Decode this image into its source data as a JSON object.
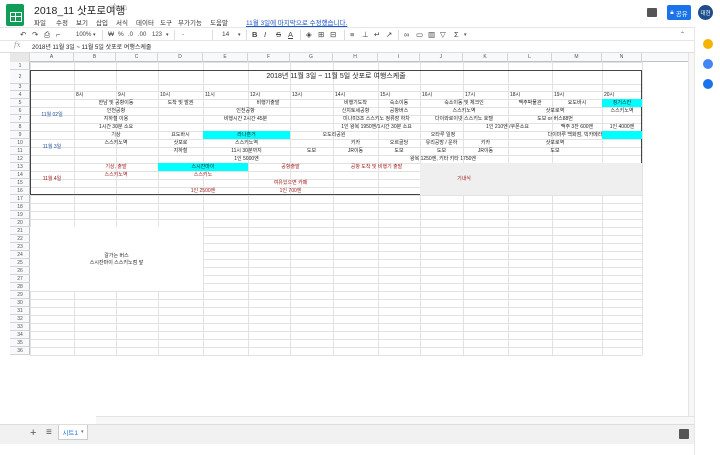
{
  "doc": {
    "title": "2018_11 삿포로여행",
    "last_edit": "11월 3일에 마지막으로 수정했습니다.",
    "share_label": "공유",
    "avatar": "대현"
  },
  "menu": [
    "파일",
    "수정",
    "보기",
    "삽입",
    "서식",
    "데이터",
    "도구",
    "부가기능",
    "도움말"
  ],
  "toolbar": {
    "zoom": "100%",
    "currency": "₩",
    "percent": "%",
    "decimal_dec": ".0",
    "decimal_inc": ".00",
    "format": "123",
    "font_size": "14",
    "bold": "B",
    "italic": "I",
    "strike": "S",
    "textcolor": "A",
    "sum": "Σ"
  },
  "formula_bar": {
    "fx": "fx",
    "value": "2018년 11월 3일 ~ 11월 5일 삿포로 여행스케줄"
  },
  "columns": [
    "A",
    "B",
    "C",
    "D",
    "E",
    "F",
    "G",
    "H",
    "I",
    "J",
    "K",
    "L",
    "M",
    "N"
  ],
  "rows": [
    "1",
    "2",
    "3",
    "4",
    "5",
    "6",
    "7",
    "8",
    "9",
    "10",
    "11",
    "12",
    "13",
    "14",
    "15",
    "16",
    "17",
    "18",
    "19",
    "20",
    "21",
    "22",
    "23",
    "24",
    "25",
    "26",
    "27",
    "28",
    "29",
    "30",
    "31",
    "32",
    "33",
    "34",
    "35",
    "36"
  ],
  "sheet": {
    "title": "2018년 11월 3일 ~ 11월 5일 삿포로 여행스케줄",
    "hours": [
      "8시",
      "9시",
      "10시",
      "11시",
      "12시",
      "13시",
      "14시",
      "15시",
      "16시",
      "17시",
      "18시",
      "19시",
      "20시"
    ],
    "day1": {
      "label": "11월 02일",
      "r5": [
        "한남 및 공항이동",
        "도착 및 발권",
        "비행기출발",
        "비행기도착",
        "숙소이동",
        "숙소이동 및 체크인",
        "맥주박물관",
        "요도바시",
        "징기스칸"
      ],
      "r6": [
        "인천공항",
        "인천공항",
        "신치토세공항",
        "공항버스",
        "스스키노역",
        "삿포로역",
        "스스키노역"
      ],
      "r7": [
        "지하철 이용",
        "비행시간 2시간 45분",
        "미나미3조 스스키노 정류장 하차",
        "다이와로이넷 스스키노 호텔",
        "도보 or 버스88번"
      ],
      "r8": [
        "1시간 30분 소요",
        "1인 왕복 1950엔/1시간 30분 소요",
        "1인 210엔 /쿠폰소요",
        "맥주 3잔 600엔",
        "1인 4000엔"
      ]
    },
    "day2": {
      "label": "11월 3일",
      "r9": [
        "기상",
        "요도바시",
        "라나훈거",
        "오도리공원",
        "오타루 일정",
        "다이마루 백화점, 빅카메라"
      ],
      "r10": [
        "스스키노역",
        "삿포로",
        "스스키노역",
        "키카",
        "오르골당",
        "유리공방 / 운하",
        "키카",
        "삿포로역"
      ],
      "r11": [
        "지하철",
        "11시 30분까지",
        "도보",
        "JR이동",
        "도보",
        "도보",
        "JR이동",
        "도보"
      ],
      "r12": [
        "1인 5000엔",
        "왕복 1250엔, 키타 키타 1750엔"
      ]
    },
    "day3": {
      "label": "11월 4일",
      "r13": [
        "기상, 출발",
        "스시잔마이",
        "공항출발",
        "공항 도착 및 비행기 출발"
      ],
      "r14": [
        "스스키노역",
        "스스키노"
      ],
      "r15": [
        "여유있으면 카페"
      ],
      "r16": [
        "1인 2500엔",
        "1인 700엔"
      ],
      "note": "기내식"
    },
    "memo": [
      "갈가는 버스",
      "스시잔마이 스스키노점 앞"
    ]
  },
  "sheet_tab": "시트1",
  "colors": {
    "highlight": "#00ffff",
    "accent": "#1a73e8",
    "brand": "#0f9d58"
  }
}
